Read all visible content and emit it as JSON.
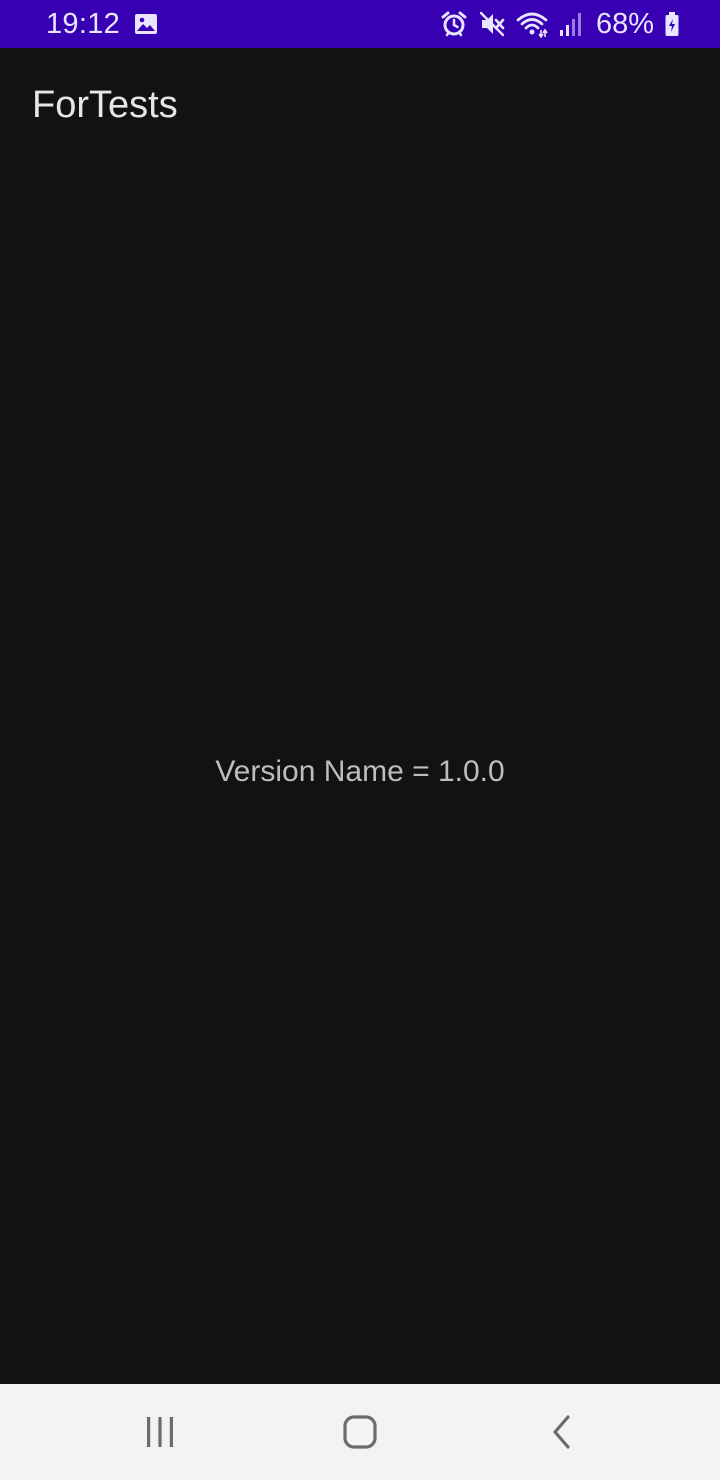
{
  "status_bar": {
    "time": "19:12",
    "battery_percent": "68%",
    "background_color": "#3700b3",
    "icons": [
      "gallery-icon",
      "alarm-icon",
      "mute-icon",
      "wifi-icon",
      "signal-icon",
      "battery-charging-icon"
    ]
  },
  "app_bar": {
    "title": "ForTests"
  },
  "main": {
    "version_text": "Version Name = 1.0.0"
  },
  "nav_bar": {
    "buttons": [
      "recent-apps-icon",
      "home-icon",
      "back-icon"
    ]
  },
  "colors": {
    "background": "#121212",
    "nav_background": "#f3f3f3"
  }
}
